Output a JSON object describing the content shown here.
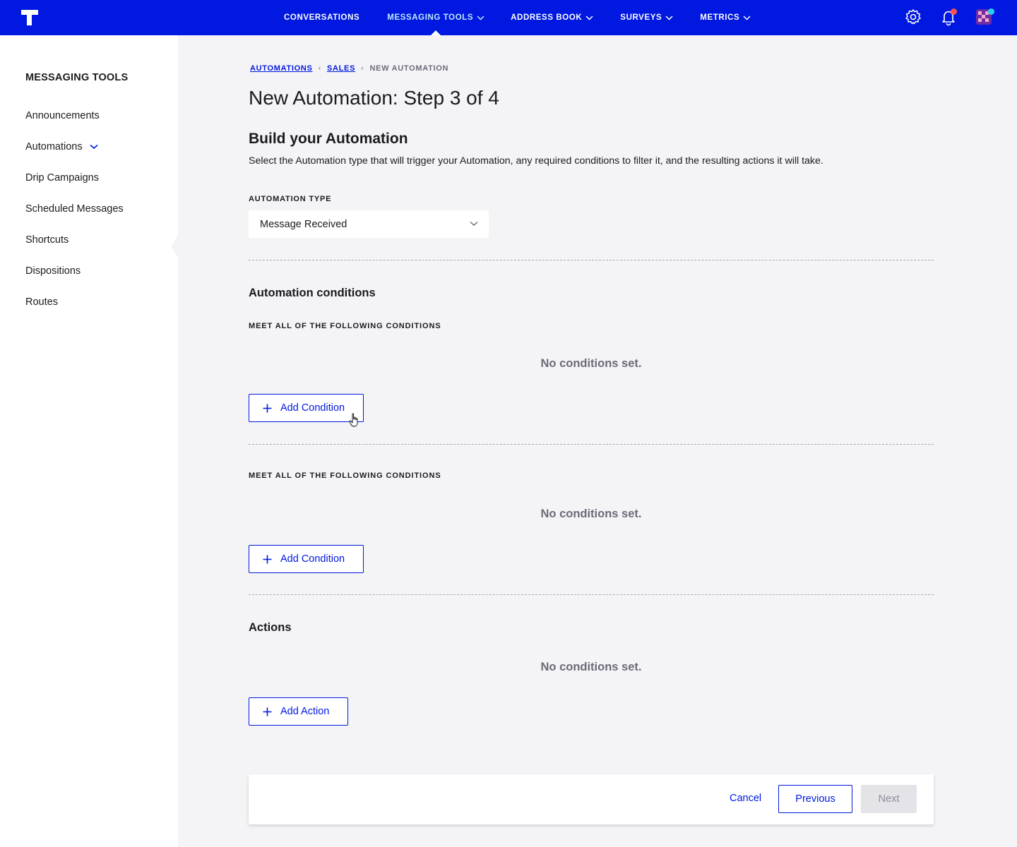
{
  "topbar": {
    "bg_color": "#0018e0",
    "logo_icon": "brand-logo-icon",
    "nav": [
      {
        "label": "CONVERSATIONS",
        "has_dropdown": false
      },
      {
        "label": "MESSAGING TOOLS",
        "has_dropdown": true,
        "active": true
      },
      {
        "label": "ADDRESS BOOK",
        "has_dropdown": true
      },
      {
        "label": "SURVEYS",
        "has_dropdown": true
      },
      {
        "label": "METRICS",
        "has_dropdown": true
      }
    ],
    "icons": [
      "gear-icon",
      "bell-icon",
      "avatar"
    ]
  },
  "sidebar": {
    "title": "MESSAGING TOOLS",
    "items": [
      {
        "label": "Announcements"
      },
      {
        "label": "Automations",
        "expanded": true
      },
      {
        "label": "Drip Campaigns"
      },
      {
        "label": "Scheduled Messages"
      },
      {
        "label": "Shortcuts"
      },
      {
        "label": "Dispositions"
      },
      {
        "label": "Routes"
      }
    ]
  },
  "breadcrumb": {
    "items": [
      "AUTOMATIONS",
      "SALES"
    ],
    "current": "NEW AUTOMATION"
  },
  "page": {
    "title": "New Automation: Step 3 of 4",
    "section_title": "Build your Automation",
    "section_desc": "Select the Automation type that will trigger your Automation, any required conditions to filter it, and the resulting actions it will take."
  },
  "automation_type": {
    "label": "AUTOMATION TYPE",
    "value": "Message Received"
  },
  "conditions": {
    "heading": "Automation conditions",
    "groups": [
      {
        "label": "MEET ALL OF THE FOLLOWING CONDITIONS",
        "empty_text": "No conditions set.",
        "button": "Add Condition"
      },
      {
        "label": "MEET ALL OF THE FOLLOWING CONDITIONS",
        "empty_text": "No conditions set.",
        "button": "Add Condition"
      }
    ]
  },
  "actions": {
    "heading": "Actions",
    "empty_text": "No conditions set.",
    "button": "Add Action"
  },
  "footer": {
    "cancel": "Cancel",
    "previous": "Previous",
    "next": "Next"
  },
  "colors": {
    "accent": "#0018e0",
    "notification_dot": "#ff4f4f",
    "avatar_status": "#22d3ee"
  }
}
